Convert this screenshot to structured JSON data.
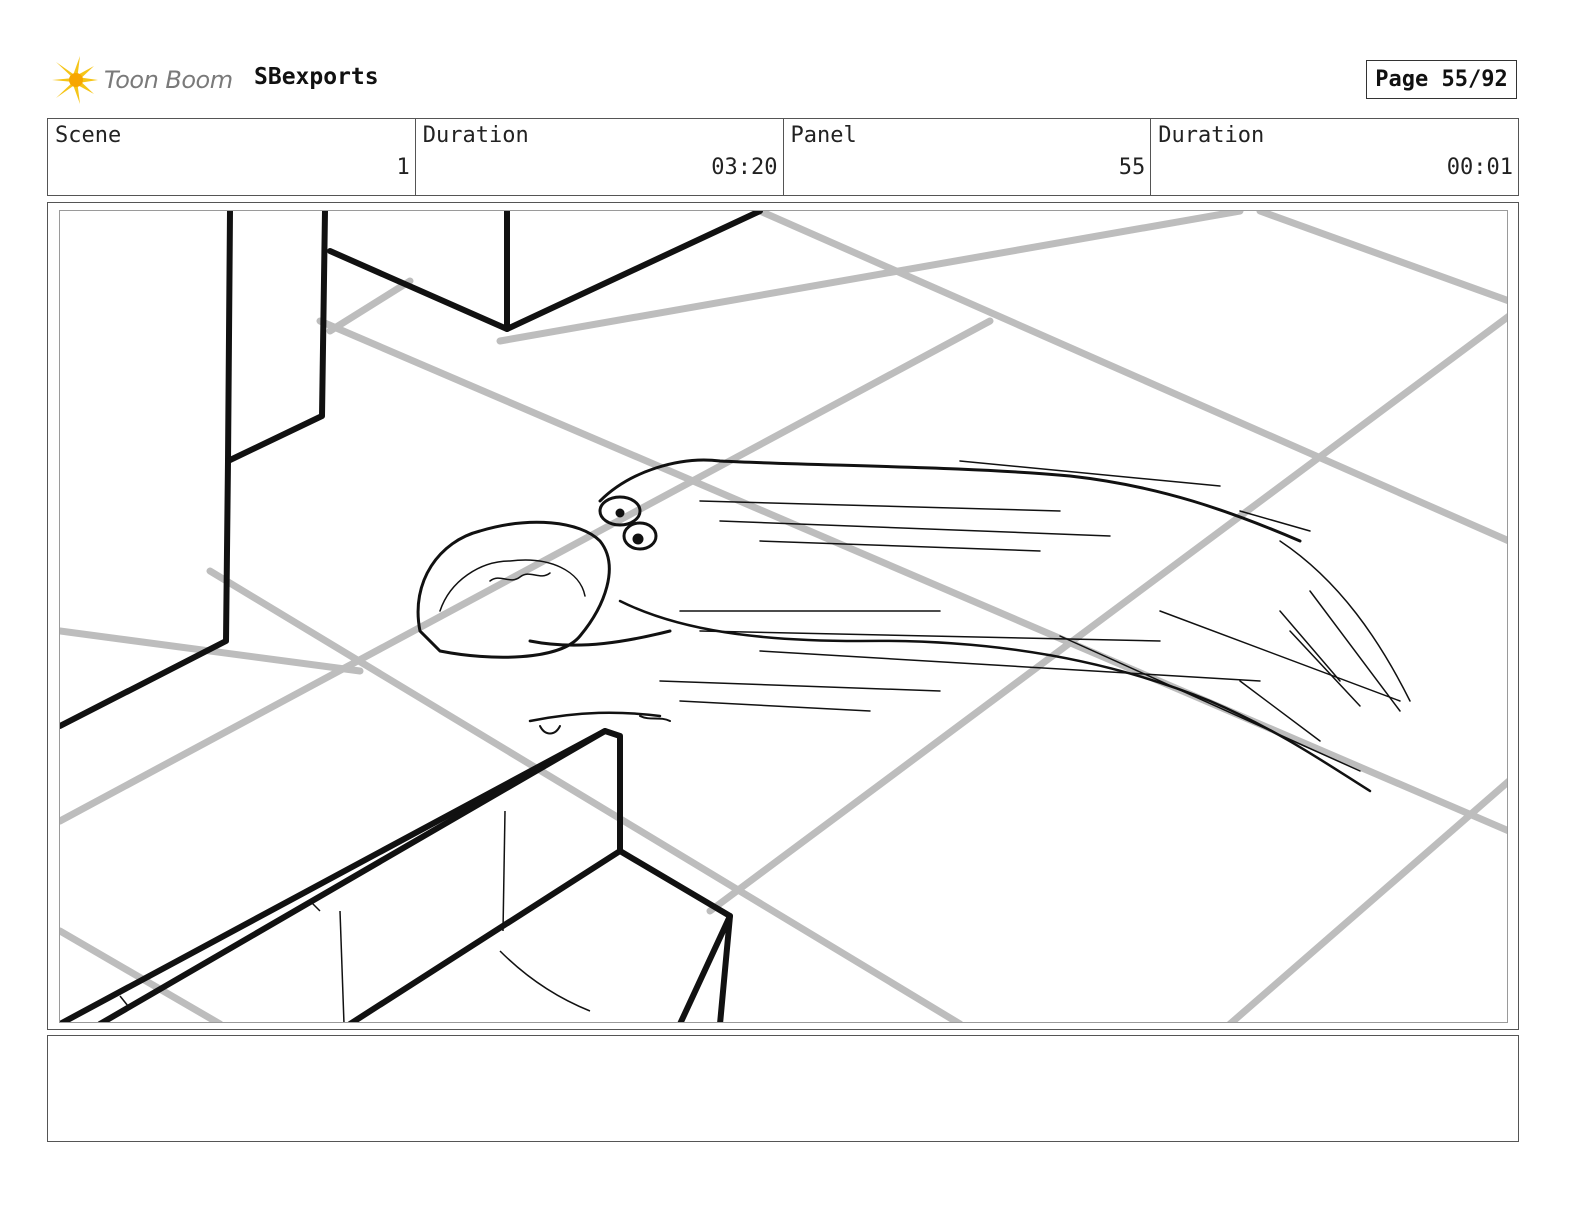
{
  "header": {
    "logo_text": "Toon Boom",
    "project": "SBexports",
    "page": "Page 55/92"
  },
  "info": {
    "scene_label": "Scene",
    "scene_value": "1",
    "scene_duration_label": "Duration",
    "scene_duration_value": "03:20",
    "panel_label": "Panel",
    "panel_value": "55",
    "panel_duration_label": "Duration",
    "panel_duration_value": "00:01"
  },
  "notes": {
    "text": ""
  },
  "colors": {
    "logo_accent": "#f5c518",
    "floor_grid": "#bdbdbd",
    "ink": "#111111"
  }
}
